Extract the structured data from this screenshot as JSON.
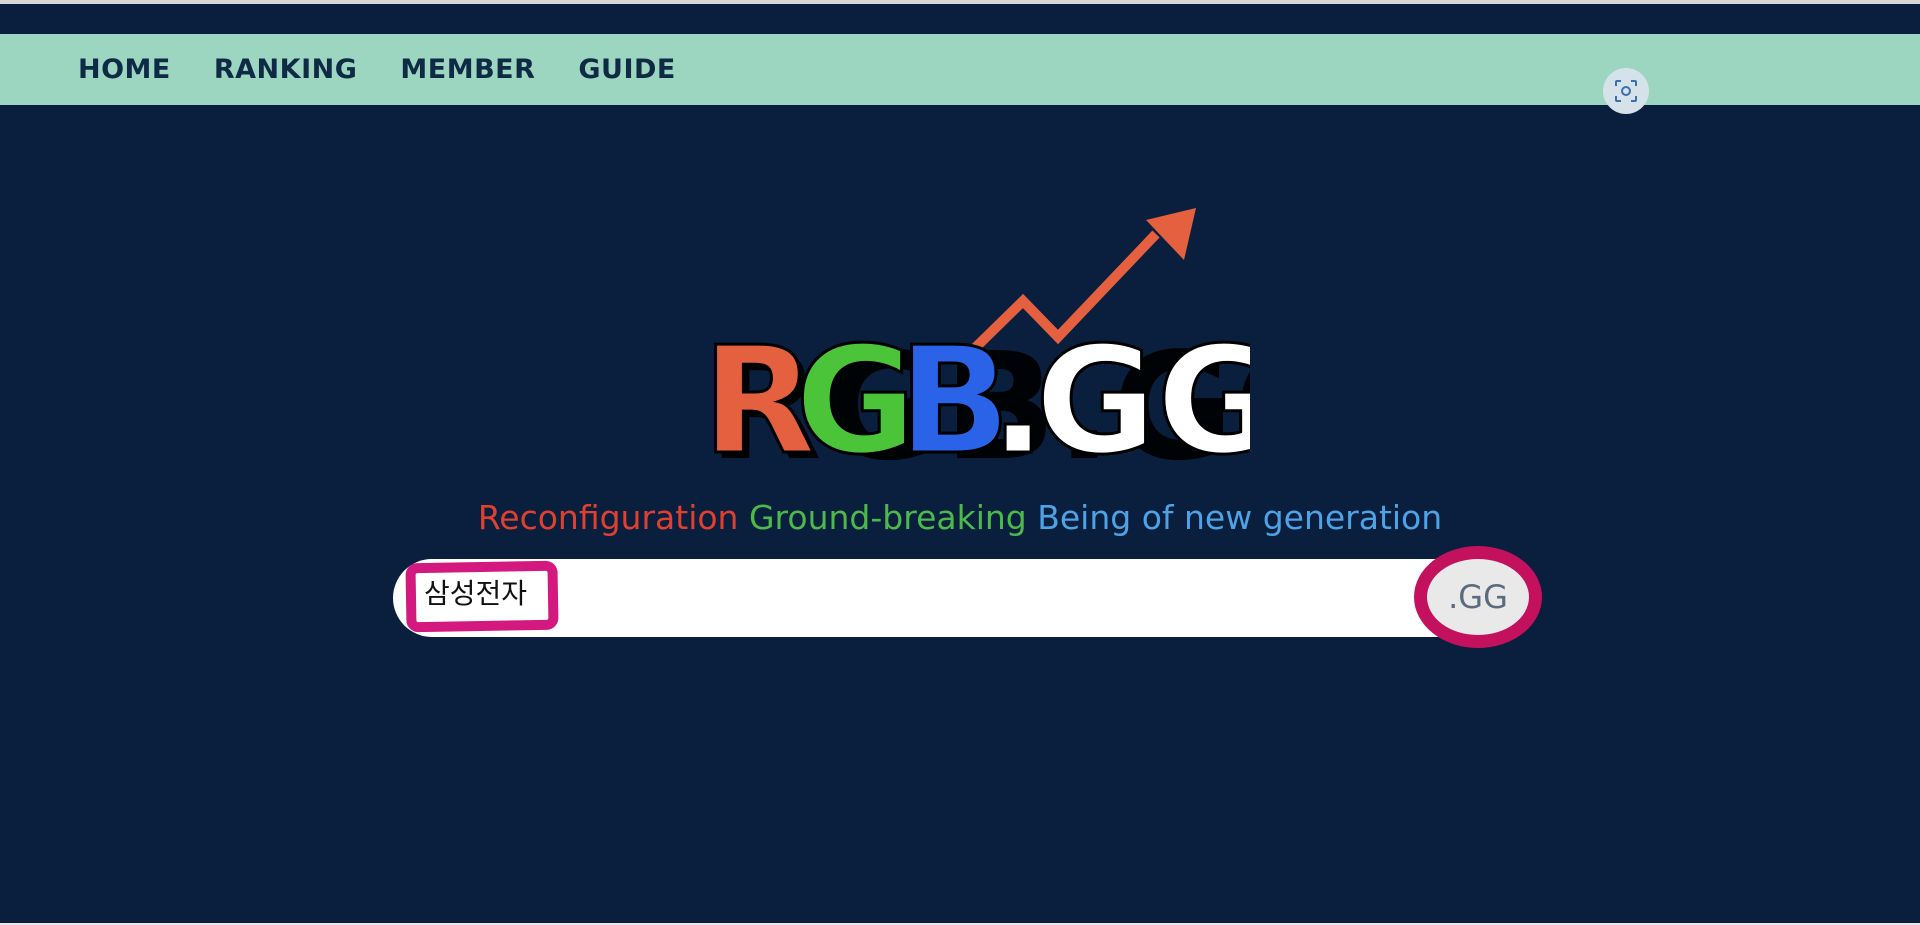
{
  "nav": {
    "items": [
      {
        "label": "HOME"
      },
      {
        "label": "RANKING"
      },
      {
        "label": "MEMBER"
      },
      {
        "label": "GUIDE"
      }
    ]
  },
  "logo": {
    "text": "RGB.GG",
    "letter_colors": {
      "R": "#e4603f",
      "G": "#4cc43a",
      "B": "#2a63e8",
      "dot_gg": "#ffffff"
    },
    "arrow_color": "#e4603f"
  },
  "tagline": {
    "part1": "Reconfiguration",
    "part2": "Ground-breaking",
    "part3": "Being of new generation"
  },
  "search": {
    "query": "삼성전자",
    "button_label": ".GG"
  },
  "icons": {
    "screenshot": "screenshot-capture-icon"
  },
  "colors": {
    "background": "#0a1f3d",
    "navbar": "#9dd6c0",
    "highlight_pink": "#d3187f",
    "highlight_magenta": "#c4115e"
  }
}
